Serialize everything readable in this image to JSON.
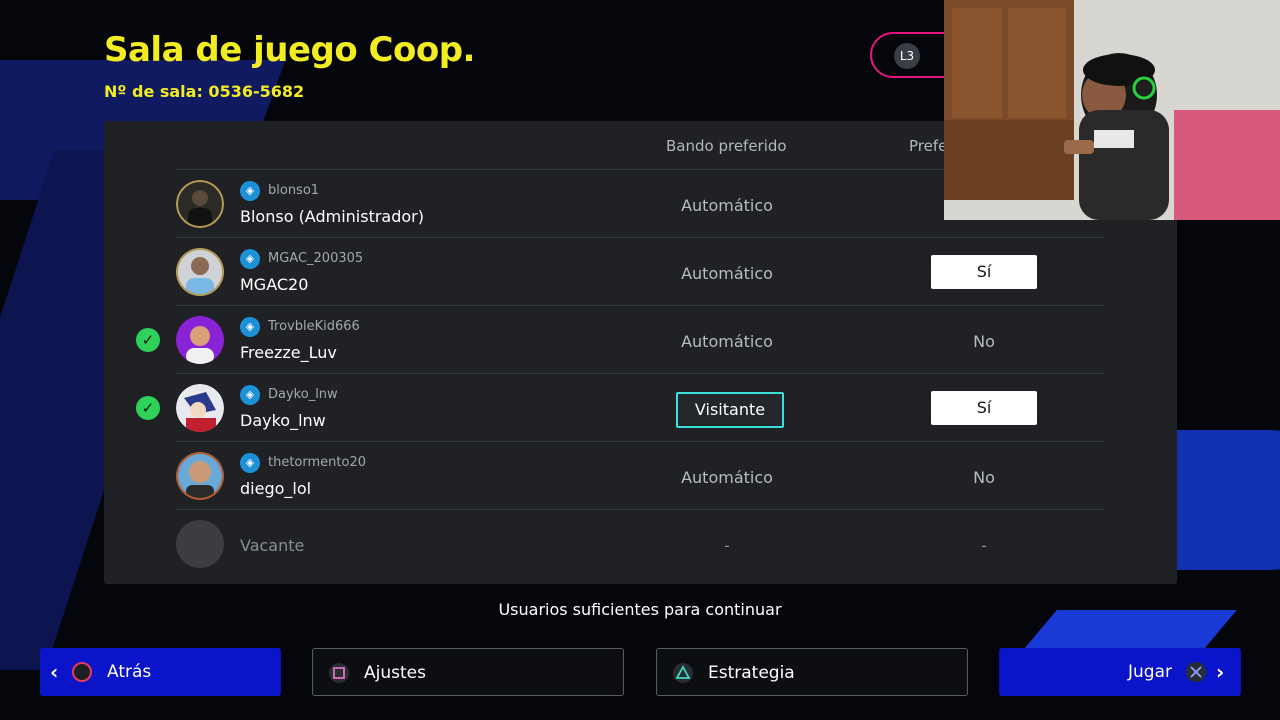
{
  "header": {
    "title": "Sala de juego Coop.",
    "room_number": "Nº de sala: 0536-5682",
    "l3_label": "L3"
  },
  "table": {
    "columns": [
      "Bando preferido",
      "Prefe"
    ],
    "rows": [
      {
        "psn": "blonso1",
        "name": "Blonso (Administrador)",
        "side": "Automático",
        "pref": "",
        "ready": false
      },
      {
        "psn": "MGAC_200305",
        "name": "MGAC20",
        "side": "Automático",
        "pref": "Sí",
        "ready": false
      },
      {
        "psn": "TrovbleKid666",
        "name": "Freezze_Luv",
        "side": "Automático",
        "pref": "No",
        "ready": true
      },
      {
        "psn": "Dayko_lnw",
        "name": "Dayko_lnw",
        "side": "Visitante",
        "pref": "Sí",
        "ready": true
      },
      {
        "psn": "thetormento20",
        "name": "diego_lol",
        "side": "Automático",
        "pref": "No",
        "ready": false
      },
      {
        "name": "Vacante",
        "side": "-",
        "pref": "-"
      }
    ]
  },
  "status_text": "Usuarios suficientes para continuar",
  "footer": {
    "back": "Atrás",
    "settings": "Ajustes",
    "strategy": "Estrategia",
    "play": "Jugar"
  },
  "colors": {
    "title_yellow": "#f2ec22",
    "accent_blue": "#0a14c8",
    "ready_green": "#2ed15a",
    "focus_cyan": "#38e0d8",
    "l3_pink": "#e0167a"
  },
  "icons": {
    "ready": "check-circle-icon",
    "platform": "playstation-icon",
    "back": "circle-button-icon",
    "settings": "square-button-icon",
    "strategy": "triangle-button-icon",
    "play": "cross-button-icon"
  }
}
